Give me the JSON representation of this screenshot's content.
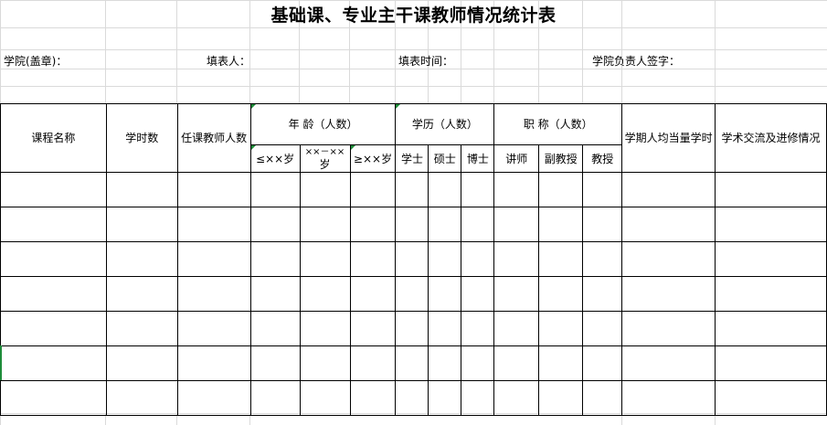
{
  "title": "基础课、专业主干课教师情况统计表",
  "meta": {
    "college": "学院(盖章)：",
    "filler": "填表人：",
    "fill_time": "填表时间：",
    "leader_sign": "学院负责人签字："
  },
  "table": {
    "headers": {
      "course_name": "课程名称",
      "hours": "学时数",
      "teacher_count": "任课教师人数",
      "age_group": "年 龄（人数）",
      "age_1": "≤××岁",
      "age_2_line1": "××－××",
      "age_2_line2": "岁",
      "age_3": "≥××岁",
      "edu_group": "学历（人数）",
      "edu_1": "学士",
      "edu_2": "硕士",
      "edu_3": "博士",
      "title_group": "职 称（人数）",
      "title_1": "讲师",
      "title_2": "副教授",
      "title_3": "教授",
      "avg_hours": "学期人均当量学时",
      "academic": "学术交流及进修情况"
    },
    "rows": [
      [
        "",
        "",
        "",
        "",
        "",
        "",
        "",
        "",
        "",
        "",
        "",
        "",
        "",
        ""
      ],
      [
        "",
        "",
        "",
        "",
        "",
        "",
        "",
        "",
        "",
        "",
        "",
        "",
        "",
        ""
      ],
      [
        "",
        "",
        "",
        "",
        "",
        "",
        "",
        "",
        "",
        "",
        "",
        "",
        "",
        ""
      ],
      [
        "",
        "",
        "",
        "",
        "",
        "",
        "",
        "",
        "",
        "",
        "",
        "",
        "",
        ""
      ],
      [
        "",
        "",
        "",
        "",
        "",
        "",
        "",
        "",
        "",
        "",
        "",
        "",
        "",
        ""
      ],
      [
        "",
        "",
        "",
        "",
        "",
        "",
        "",
        "",
        "",
        "",
        "",
        "",
        "",
        ""
      ],
      [
        "",
        "",
        "",
        "",
        "",
        "",
        "",
        "",
        "",
        "",
        "",
        "",
        "",
        ""
      ]
    ]
  }
}
